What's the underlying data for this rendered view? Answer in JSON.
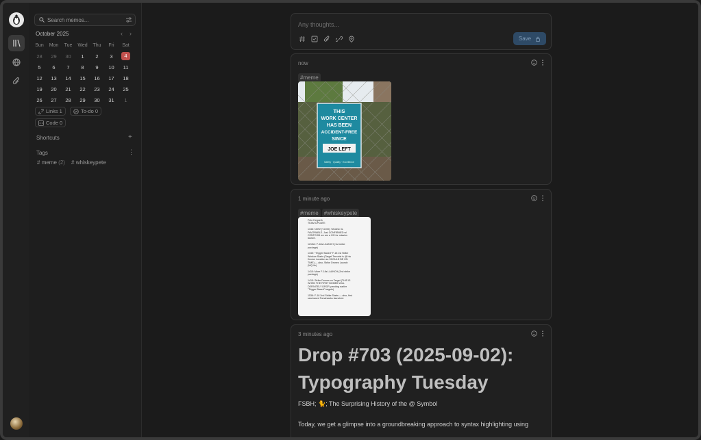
{
  "sidebar": {
    "search_placeholder": "Search memos...",
    "calendar": {
      "month": "October 2025",
      "weekdays": [
        "Sun",
        "Mon",
        "Tue",
        "Wed",
        "Thu",
        "Fri",
        "Sat"
      ],
      "weeks": [
        [
          "28",
          "29",
          "30",
          "1",
          "2",
          "3",
          "4"
        ],
        [
          "5",
          "6",
          "7",
          "8",
          "9",
          "10",
          "11"
        ],
        [
          "12",
          "13",
          "14",
          "15",
          "16",
          "17",
          "18"
        ],
        [
          "19",
          "20",
          "21",
          "22",
          "23",
          "24",
          "25"
        ],
        [
          "26",
          "27",
          "28",
          "29",
          "30",
          "31",
          "1"
        ]
      ],
      "today": "4"
    },
    "filters": {
      "links": "Links 1",
      "todo": "To-do 0",
      "code": "Code 0"
    },
    "shortcuts_label": "Shortcuts",
    "tags_label": "Tags",
    "tags": [
      {
        "name": "meme",
        "count": "(2)"
      },
      {
        "name": "whiskeypete",
        "count": ""
      }
    ]
  },
  "editor": {
    "placeholder": "Any thoughts...",
    "save_label": "Save"
  },
  "memos": [
    {
      "time": "now",
      "tags": [
        "#meme"
      ],
      "sign": {
        "l1": "THIS",
        "l2": "WORK CENTER",
        "l3": "HAS BEEN",
        "l4": "ACCIDENT-FREE",
        "l5": "SINCE",
        "l6": "JOE LEFT",
        "foot": "Safety · Quality · Excellence"
      }
    },
    {
      "time": "1 minute ago",
      "tags": [
        "#meme",
        "#whiskeypete"
      ],
      "doc_lines": [
        "Pete Hegseth",
        "TEAM UPDATE:",
        "",
        "1346: NOW (T-8:00): Weather is",
        "FAVORABLE. Just CONFIRMED w/",
        "CENTCOM we are a GO for mission",
        "launch.",
        "",
        "1215et: F-18s LAUNCH (1st strike",
        "package)",
        "",
        "1345: \"Trigger Based\" F-18 1st Strike",
        "Window Starts (Target Terrorist is @ his",
        "Known Location so SHOULD BE ON",
        "TIME) — also, Strike Drones Launch",
        "(MQ-9s)",
        "",
        "1410: More F-18s LAUNCH (2nd strike",
        "package)",
        "",
        "1415: Strike Drones on Target (THIS IS",
        "WHEN THE FIRST BOMBS WILL",
        "DEFINITELY DROP, pending earlier",
        "\"Trigger Based\" targets)",
        "",
        "1536: F-18 2nd Strike Starts — also, first",
        "sea-based Tomahawks launched."
      ]
    },
    {
      "time": "3 minutes ago",
      "title_l1": "Drop #703 (2025-09-02):",
      "title_l2": "Typography Tuesday",
      "subtitle": "FSBH; 🐈; The Surprising History of the @ Symbol",
      "body": "Today, we get a glimpse into a groundbreaking approach to syntax highlighting using"
    }
  ]
}
